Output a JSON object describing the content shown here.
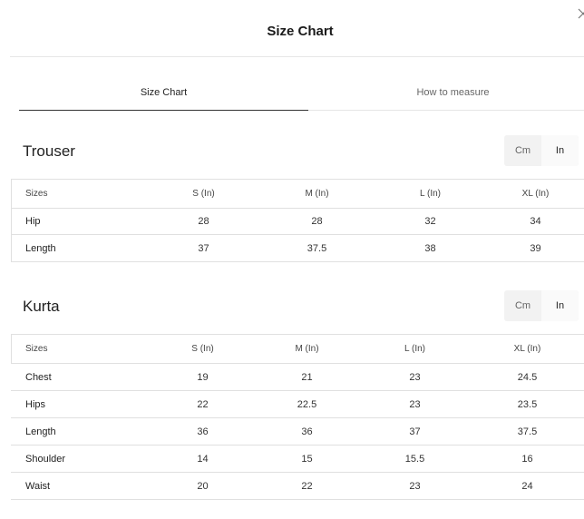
{
  "modal": {
    "title": "Size Chart",
    "close_icon": "close-icon"
  },
  "tabs": [
    {
      "label": "Size Chart",
      "active": true
    },
    {
      "label": "How to measure",
      "active": false
    }
  ],
  "units": {
    "cm_label": "Cm",
    "in_label": "In",
    "selected": "In"
  },
  "trouser": {
    "title": "Trouser",
    "headers": [
      "Sizes",
      "S (In)",
      "M (In)",
      "L (In)",
      "XL (In)"
    ],
    "rows": [
      {
        "label": "Hip",
        "values": [
          "28",
          "28",
          "32",
          "34"
        ]
      },
      {
        "label": "Length",
        "values": [
          "37",
          "37.5",
          "38",
          "39"
        ]
      }
    ]
  },
  "kurta": {
    "title": "Kurta",
    "headers": [
      "Sizes",
      "S (In)",
      "M (In)",
      "L (In)",
      "XL (In)"
    ],
    "rows": [
      {
        "label": "Chest",
        "values": [
          "19",
          "21",
          "23",
          "24.5"
        ]
      },
      {
        "label": "Hips",
        "values": [
          "22",
          "22.5",
          "23",
          "23.5"
        ]
      },
      {
        "label": "Length",
        "values": [
          "36",
          "36",
          "37",
          "37.5"
        ]
      },
      {
        "label": "Shoulder",
        "values": [
          "14",
          "15",
          "15.5",
          "16"
        ]
      },
      {
        "label": "Waist",
        "values": [
          "20",
          "22",
          "23",
          "24"
        ]
      }
    ]
  }
}
